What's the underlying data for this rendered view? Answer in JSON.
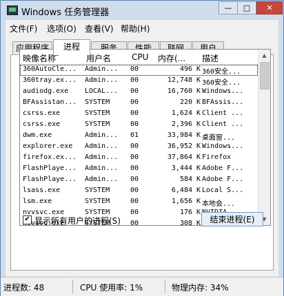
{
  "window": {
    "title": "Windows 任务管理器",
    "buttons": {
      "minimize": "—",
      "maximize": "□",
      "close": "✕"
    }
  },
  "menu": [
    "文件(F)",
    "选项(O)",
    "查看(V)",
    "帮助(H)"
  ],
  "tabs": [
    "应用程序",
    "进程",
    "服务",
    "性能",
    "联网",
    "用户"
  ],
  "active_tab": "进程",
  "columns": [
    "映像名称",
    "用户名",
    "CPU",
    "内存(...",
    "描述"
  ],
  "processes": [
    {
      "name": "360AutoCle...",
      "user": "Admin...",
      "cpu": "00",
      "mem": "496",
      "unit": "K",
      "desc": "360安全..."
    },
    {
      "name": "360tray.ex...",
      "user": "Admin...",
      "cpu": "00",
      "mem": "12,748",
      "unit": "K",
      "desc": "360安全..."
    },
    {
      "name": "audiodg.exe",
      "user": "LOCAL...",
      "cpu": "00",
      "mem": "16,760",
      "unit": "K",
      "desc": "Windows..."
    },
    {
      "name": "BFAssistan...",
      "user": "SYSTEM",
      "cpu": "00",
      "mem": "220",
      "unit": "K",
      "desc": "BFAssis..."
    },
    {
      "name": "csrss.exe",
      "user": "SYSTEM",
      "cpu": "00",
      "mem": "1,624",
      "unit": "K",
      "desc": "Client ..."
    },
    {
      "name": "csrss.exe",
      "user": "SYSTEM",
      "cpu": "00",
      "mem": "2,396",
      "unit": "K",
      "desc": "Client ..."
    },
    {
      "name": "dwm.exe",
      "user": "Admin...",
      "cpu": "01",
      "mem": "33,984",
      "unit": "K",
      "desc": "桌面窗..."
    },
    {
      "name": "explorer.exe",
      "user": "Admin...",
      "cpu": "00",
      "mem": "36,952",
      "unit": "K",
      "desc": "Windows..."
    },
    {
      "name": "firefox.ex...",
      "user": "Admin...",
      "cpu": "00",
      "mem": "37,864",
      "unit": "K",
      "desc": "Firefox"
    },
    {
      "name": "FlashPlaye...",
      "user": "Admin...",
      "cpu": "00",
      "mem": "3,444",
      "unit": "K",
      "desc": "Adobe F..."
    },
    {
      "name": "FlashPlaye...",
      "user": "Admin...",
      "cpu": "00",
      "mem": "584",
      "unit": "K",
      "desc": "Adobe F..."
    },
    {
      "name": "lsass.exe",
      "user": "SYSTEM",
      "cpu": "00",
      "mem": "6,484",
      "unit": "K",
      "desc": "Local S..."
    },
    {
      "name": "lsm.exe",
      "user": "SYSTEM",
      "cpu": "00",
      "mem": "1,656",
      "unit": "K",
      "desc": "本地会..."
    },
    {
      "name": "nvvsvc.exe",
      "user": "SYSTEM",
      "cpu": "00",
      "mem": "176",
      "unit": "K",
      "desc": "NVIDIA ..."
    },
    {
      "name": "nvvsvc.exe",
      "user": "SYSTEM",
      "cpu": "00",
      "mem": "308",
      "unit": "K",
      "desc": "NVIDIA ..."
    }
  ],
  "show_all_users": {
    "label": "显示所有用户的进程(S)",
    "checked": true,
    "check_glyph": "✔"
  },
  "end_process_button": "结束进程(E)",
  "status": {
    "processes": "进程数: 48",
    "cpu": "CPU 使用率: 1%",
    "memory": "物理内存: 34%"
  }
}
